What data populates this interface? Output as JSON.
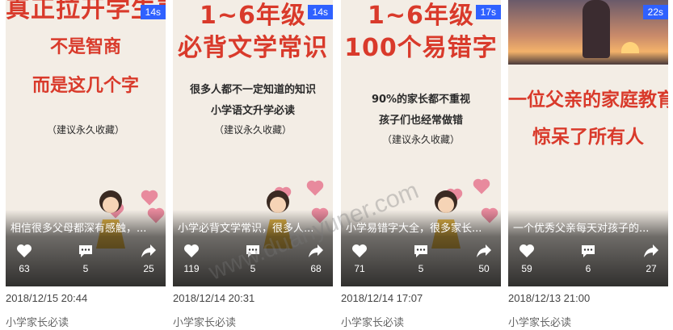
{
  "cards": [
    {
      "duration": "14s",
      "poster_lines": [
        "真正拉开学生差距",
        "不是智商",
        "而是这几个字",
        "（建议永久收藏）"
      ],
      "caption": "相信很多父母都深有感触，...",
      "likes": "63",
      "comments": "5",
      "shares": "25",
      "date": "2018/12/15 20:44",
      "author": "小学家长必读"
    },
    {
      "duration": "14s",
      "poster_lines": [
        "1~6年级",
        "必背文学常识",
        "很多人都不一定知道的知识",
        "小学语文升学必读",
        "（建议永久收藏）"
      ],
      "caption": "小学必背文学常识，很多人...",
      "likes": "119",
      "comments": "5",
      "shares": "68",
      "date": "2018/12/14 20:31",
      "author": "小学家长必读"
    },
    {
      "duration": "17s",
      "poster_lines": [
        "1~6年级",
        "100个易错字",
        "90%的家长都不重视",
        "孩子们也经常做错",
        "（建议永久收藏）"
      ],
      "caption": "小学易错字大全，很多家长...",
      "likes": "71",
      "comments": "5",
      "shares": "50",
      "date": "2018/12/14 17:07",
      "author": "小学家长必读"
    },
    {
      "duration": "22s",
      "poster_lines": [
        "一位父亲的家庭教育",
        "惊呆了所有人"
      ],
      "caption": "一个优秀父亲每天对孩子的...",
      "likes": "59",
      "comments": "6",
      "shares": "27",
      "date": "2018/12/13 21:00",
      "author": "小学家长必读"
    }
  ],
  "watermark": "www.duanyuner.com",
  "colors": {
    "badge": "#2f61ff",
    "poster_red": "#d93a2b"
  }
}
